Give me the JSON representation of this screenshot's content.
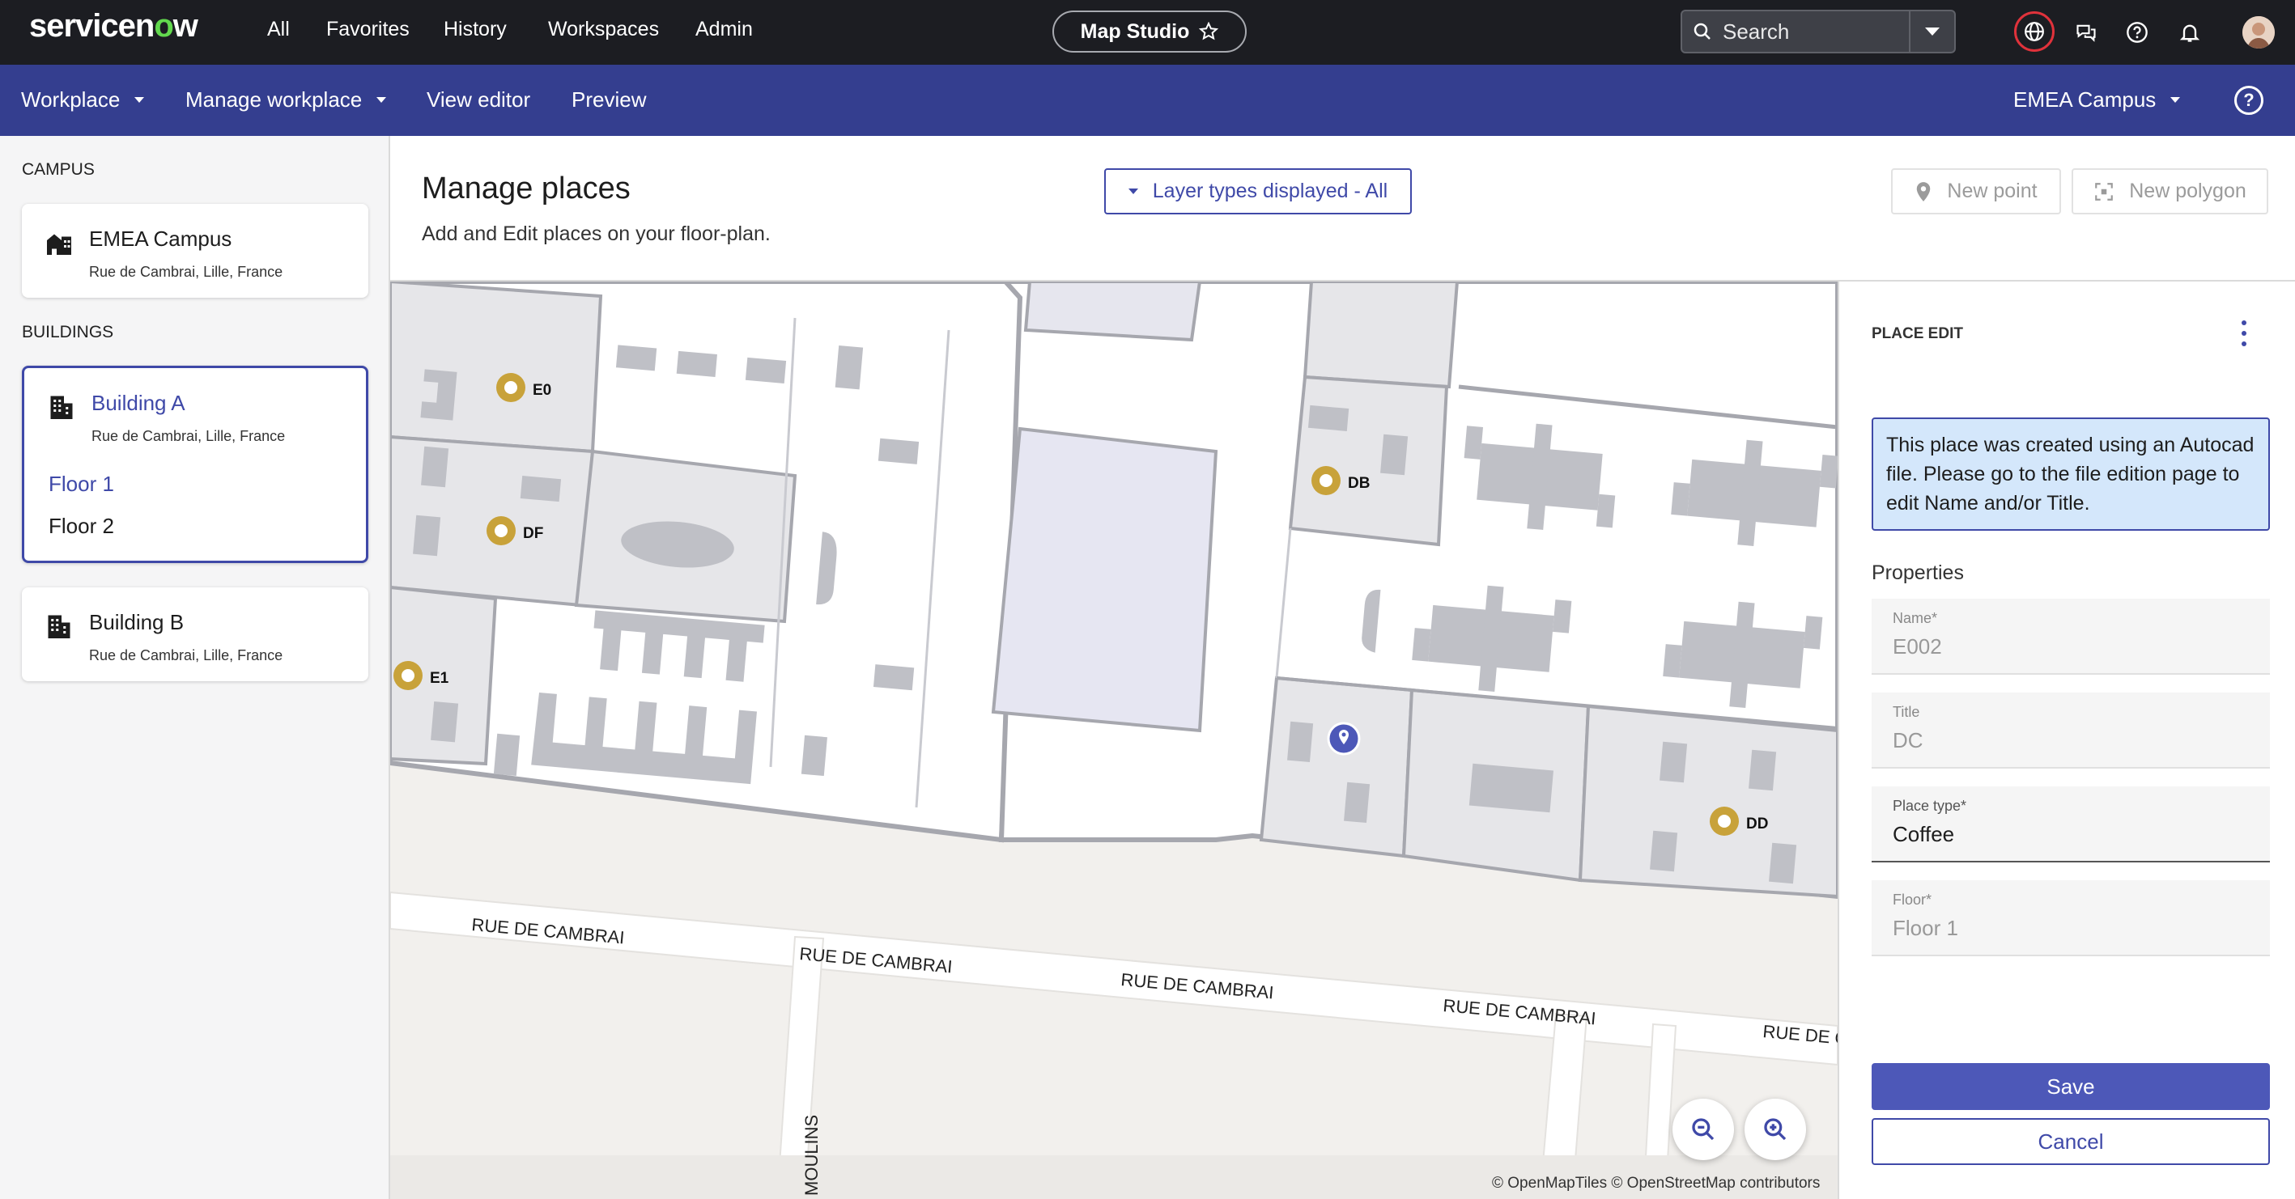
{
  "topnav": {
    "logo": "servicenow",
    "links": [
      "All",
      "Favorites",
      "History",
      "Workspaces",
      "Admin"
    ],
    "app_title": "Map Studio",
    "search_placeholder": "Search",
    "icons": [
      "globe-icon",
      "chat-icon",
      "help-icon",
      "bell-icon",
      "avatar"
    ]
  },
  "subnav": {
    "workplace": "Workplace",
    "manage_workplace": "Manage workplace",
    "view_editor": "View editor",
    "preview": "Preview",
    "campus_select": "EMEA Campus"
  },
  "left": {
    "campus_heading": "CAMPUS",
    "campus": {
      "name": "EMEA Campus",
      "address": "Rue de Cambrai, Lille, France"
    },
    "buildings_heading": "BUILDINGS",
    "building_a": {
      "name": "Building A",
      "address": "Rue de Cambrai, Lille, France",
      "floors": [
        "Floor 1",
        "Floor 2"
      ]
    },
    "building_b": {
      "name": "Building B",
      "address": "Rue de Cambrai, Lille, France"
    }
  },
  "header": {
    "title": "Manage places",
    "subtitle": "Add and Edit places on your floor-plan.",
    "layer_button": "Layer types displayed - All",
    "new_point": "New point",
    "new_polygon": "New polygon"
  },
  "map": {
    "markers": [
      "E0",
      "DF",
      "E1",
      "DB",
      "DD"
    ],
    "streets": [
      "RUE DE CAMBRAI",
      "RUE DE CAMBRAI",
      "RUE DE CAMBRAI",
      "RUE DE CAMBRAI",
      "RUE DE C",
      "MOULINS"
    ],
    "credit": "© OpenMapTiles © OpenStreetMap contributors",
    "colors": {
      "marker": "#c8a23a",
      "selected_marker": "#4d58b8",
      "building": "#ffffff",
      "room": "#e6e6e9",
      "furniture": "#bfc0c6"
    }
  },
  "panel": {
    "title": "PLACE EDIT",
    "info": "This place was created using an Autocad file. Please go to the file edition page to edit Name and/or Title.",
    "properties_label": "Properties",
    "fields": [
      {
        "label": "Name*",
        "value": "E002"
      },
      {
        "label": "Title",
        "value": "DC"
      },
      {
        "label": "Place type*",
        "value": "Coffee"
      },
      {
        "label": "Floor*",
        "value": "Floor 1"
      }
    ],
    "save": "Save",
    "cancel": "Cancel"
  },
  "colors": {
    "topnav": "#1c1d22",
    "subnav": "#343e8f",
    "accent": "#3f49a8",
    "info_bg": "#d4e7fb"
  }
}
